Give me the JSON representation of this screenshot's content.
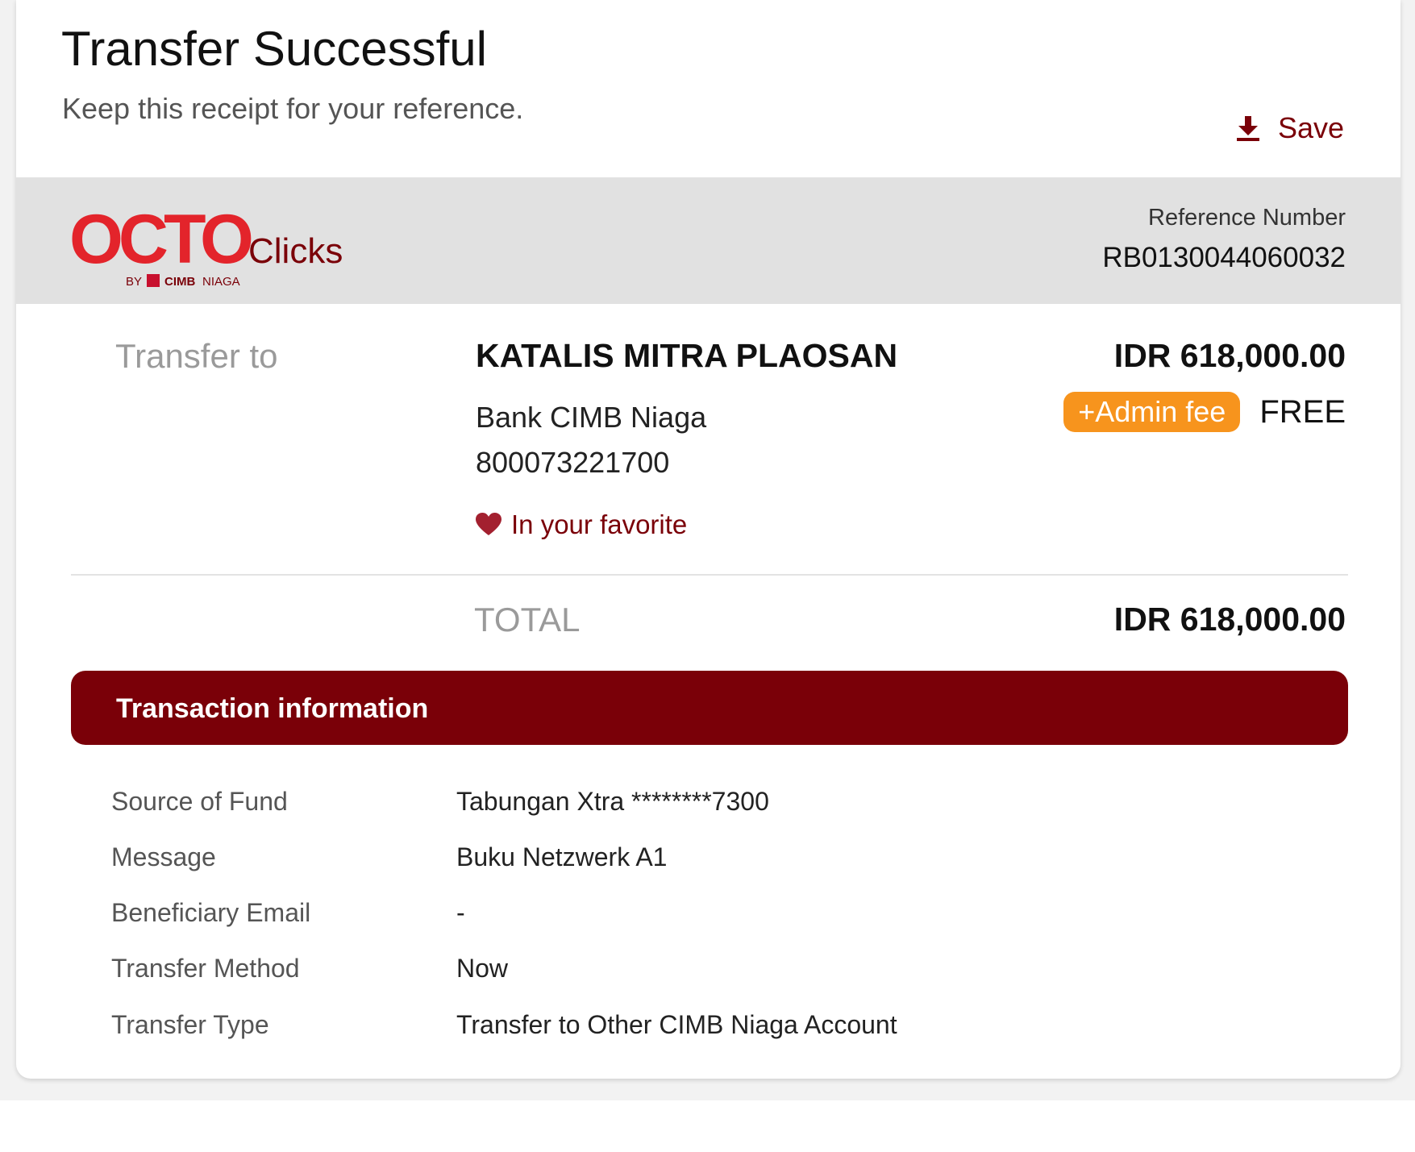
{
  "header": {
    "title": "Transfer Successful",
    "subtitle": "Keep this receipt for your reference.",
    "save_label": "Save"
  },
  "brand": {
    "logo_name": "OCTO Clicks by CIMB Niaga",
    "primary_color": "#7a0008",
    "logo_red": "#e3242b",
    "fee_badge_color": "#f7941d"
  },
  "reference": {
    "label": "Reference Number",
    "value": "RB0130044060032"
  },
  "transfer": {
    "label": "Transfer to",
    "recipient_name": "KATALIS MITRA PLAOSAN",
    "bank": "Bank CIMB Niaga",
    "account_number": "800073221700",
    "favorite_text": "In your favorite",
    "amount": "IDR 618,000.00",
    "admin_fee_label": "+Admin fee",
    "admin_fee_value": "FREE"
  },
  "total": {
    "label": "TOTAL",
    "value": "IDR 618,000.00"
  },
  "transaction_info": {
    "title": "Transaction information",
    "rows": [
      {
        "label": "Source of Fund",
        "value": "Tabungan Xtra ********7300"
      },
      {
        "label": "Message",
        "value": "Buku Netzwerk A1"
      },
      {
        "label": "Beneficiary Email",
        "value": "-"
      },
      {
        "label": "Transfer Method",
        "value": "Now"
      },
      {
        "label": "Transfer Type",
        "value": "Transfer to Other CIMB Niaga Account"
      }
    ]
  }
}
